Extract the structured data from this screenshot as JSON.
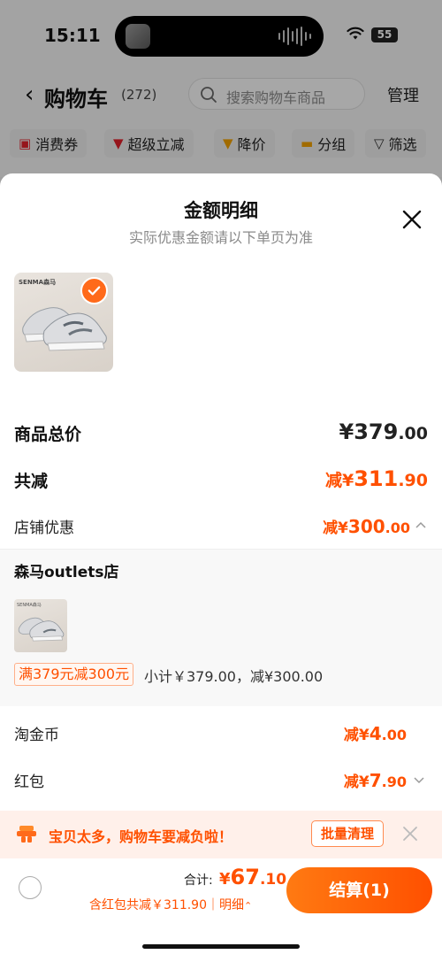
{
  "status": {
    "time": "15:11",
    "battery": "55"
  },
  "cart": {
    "title": "购物车",
    "count": "(272)",
    "search_placeholder": "搜索购物车商品",
    "manage": "管理"
  },
  "chips": [
    {
      "label": "消费券",
      "icon": "coupon-icon"
    },
    {
      "label": "超级立减",
      "icon": "arrow-down-icon"
    },
    {
      "label": "降价",
      "icon": "arrow-down-icon"
    },
    {
      "label": "分组",
      "icon": "folder-icon"
    },
    {
      "label": "筛选",
      "icon": "filter-icon"
    }
  ],
  "sheet": {
    "title": "金额明细",
    "subtitle": "实际优惠金额请以下单页为准",
    "product_brand": "SENMA森马",
    "rows": {
      "total_label": "商品总价",
      "total_symbol": "¥",
      "total_int": "379",
      "total_dec": ".00",
      "reduce_label": "共减",
      "reduce_prefix": "减¥",
      "reduce_int": "311",
      "reduce_dec": ".90",
      "shop_label": "店铺优惠",
      "shop_prefix": "减¥",
      "shop_int": "300",
      "shop_dec": ".00",
      "coin_label": "淘金币",
      "coin_prefix": "减¥",
      "coin_int": "4",
      "coin_dec": ".00",
      "redpack_label": "红包",
      "redpack_prefix": "减¥",
      "redpack_int": "7",
      "redpack_dec": ".90"
    },
    "store": {
      "name": "森马outlets店",
      "thumb_brand": "SENMA森马",
      "promo": "满379元减300元",
      "subtotal": "小计￥379.00，减¥300.00"
    }
  },
  "warning": {
    "text": "宝贝太多，购物车要减负啦！",
    "button": "批量清理"
  },
  "bottom": {
    "total_label": "合计:",
    "total_symbol": "¥",
    "total_int": "67",
    "total_dec": ".10",
    "sub": "含红包共减￥311.90｜明细",
    "checkout": "结算(1)"
  },
  "colors": {
    "accent": "#ff5000",
    "accent_light": "#fff0ea"
  }
}
